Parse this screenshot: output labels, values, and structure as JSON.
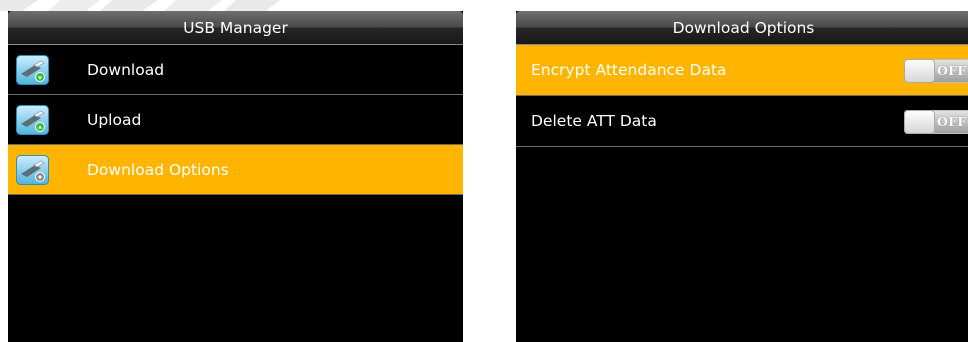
{
  "colors": {
    "highlight": "#ffb400",
    "screen_background": "#000000",
    "divider": "#6a6a6a",
    "text": "#ffffff"
  },
  "left_screen": {
    "title": "USB Manager",
    "items": [
      {
        "label": "Download",
        "icon": "usb-download-icon",
        "selected": false
      },
      {
        "label": "Upload",
        "icon": "usb-upload-icon",
        "selected": false
      },
      {
        "label": "Download Options",
        "icon": "usb-options-icon",
        "selected": true
      }
    ]
  },
  "right_screen": {
    "title": "Download Options",
    "options": [
      {
        "label": "Encrypt Attendance Data",
        "toggle_text": "OFF",
        "enabled": false,
        "selected": true
      },
      {
        "label": "Delete ATT Data",
        "toggle_text": "OFF",
        "enabled": false,
        "selected": false
      }
    ]
  }
}
